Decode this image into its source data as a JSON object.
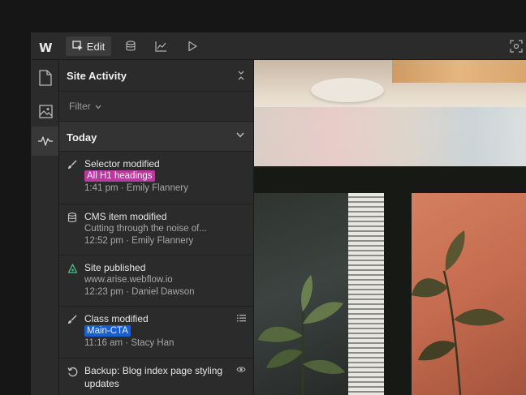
{
  "topbar": {
    "logo": "W",
    "edit_label": "Edit",
    "icons": [
      "cursor-icon",
      "database-icon",
      "chart-icon",
      "play-icon",
      "capture-icon"
    ]
  },
  "sidebar": {
    "icons": [
      "page-icon",
      "image-icon",
      "activity-icon"
    ]
  },
  "panel": {
    "title": "Site Activity",
    "filter_label": "Filter",
    "section_label": "Today",
    "activities": [
      {
        "icon": "brush-icon",
        "title": "Selector modified",
        "tag": "All H1 headings",
        "tag_color": "#b83aa0",
        "meta": "1:41 pm · Emily Flannery"
      },
      {
        "icon": "database-icon",
        "title": "CMS item modified",
        "detail": "Cutting through the noise of...",
        "meta": "12:52 pm · Emily Flannery"
      },
      {
        "icon": "publish-icon",
        "title": "Site published",
        "detail": "www.arise.webflow.io",
        "meta": "12:23 pm · Daniel Dawson"
      },
      {
        "icon": "brush-icon",
        "title": "Class modified",
        "tag": "Main-CTA",
        "tag_color": "#1a5fd0",
        "meta": "11:16 am · Stacy Han"
      },
      {
        "icon": "restore-icon",
        "title": "Backup: Blog index page styling",
        "detail": "updates"
      }
    ]
  },
  "colors": {
    "accent_green": "#4fc28b",
    "background": "#2b2b2b"
  }
}
